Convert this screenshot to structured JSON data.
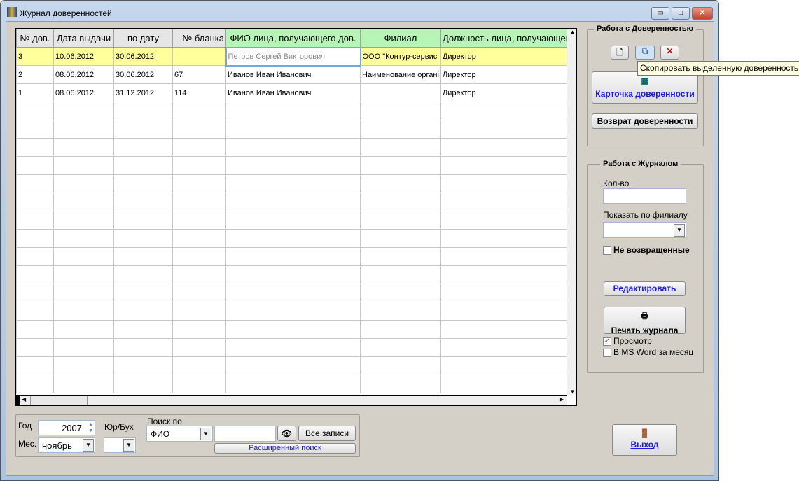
{
  "window": {
    "title": "Журнал доверенностей",
    "minimize": "▭",
    "maximize": "□",
    "close": "✕"
  },
  "grid": {
    "columns": [
      "№ дов.",
      "Дата выдачи",
      "по дату",
      "№ бланка",
      "ФИО лица, получающего дов.",
      "Филиал",
      "Должность лица, получающег"
    ],
    "rows": [
      [
        "3",
        "10.06.2012",
        "30.06.2012",
        "",
        "Петров Сергей Викторович",
        "ООО \"Контур-сервис",
        "Директор"
      ],
      [
        "2",
        "08.06.2012",
        "30.06.2012",
        "67",
        "Иванов Иван Иванович",
        "Наименование органі",
        "Лиректор"
      ],
      [
        "1",
        "08.06.2012",
        "31.12.2012",
        "114",
        "Иванов Иван Иванович",
        "",
        "Лиректор"
      ]
    ]
  },
  "power": {
    "title": "Работа с Доверенностью",
    "tooltip": "Скопировать выделенную доверенность",
    "card": "Карточка доверенности",
    "return": "Возврат доверенности"
  },
  "journal": {
    "title": "Работа с Журналом",
    "qty_label": "Кол-во",
    "qty_value": "",
    "branch_label": "Показать по филиалу",
    "branch_value": "",
    "not_returned": "Не возвращенные",
    "edit": "Редактировать",
    "print": "Печать журнала",
    "preview": "Просмотр",
    "msword": "В MS Word за месяц"
  },
  "filter": {
    "year_label": "Год",
    "year": "2007",
    "month_label": "Мес.",
    "month": "ноябрь",
    "type_label": "Юр/Бух",
    "type_value": "",
    "search_label": "Поиск по",
    "search_field": "ФИО",
    "search_text": "",
    "all_records": "Все записи",
    "advanced": "Расширенный поиск"
  },
  "exit": "Выход"
}
